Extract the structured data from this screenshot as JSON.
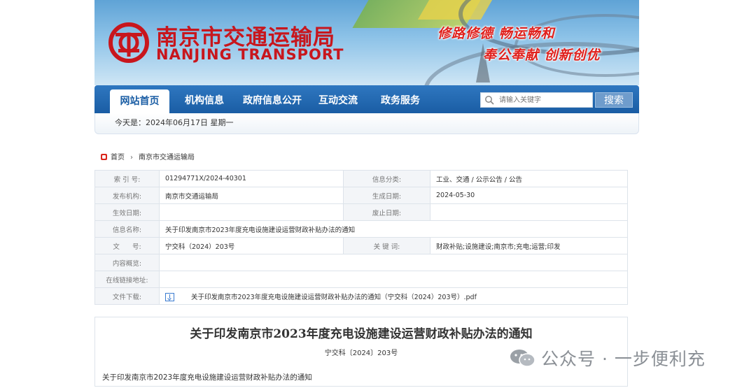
{
  "banner": {
    "site_name_cn": "南京市交通运输局",
    "site_name_en": "NANJING TRANSPORT",
    "slogan_line1": "修路修德  畅运畅和",
    "slogan_line2": "奉公奉献  创新创优"
  },
  "nav": {
    "items": [
      {
        "label": "网站首页"
      },
      {
        "label": "机构信息"
      },
      {
        "label": "政府信息公开"
      },
      {
        "label": "互动交流"
      },
      {
        "label": "政务服务"
      }
    ],
    "search_placeholder": "请输入关键字",
    "search_button": "搜索"
  },
  "dateline": "今天是：2024年06月17日  星期一",
  "breadcrumb": {
    "home": "首页",
    "current": "南京市交通运输局"
  },
  "info": {
    "index_label": "索 引 号:",
    "index_value": "01294771X/2024-40301",
    "category_label": "信息分类:",
    "category_value": "工业、交通 / 公示公告 / 公告",
    "publisher_label": "发布机构:",
    "publisher_value": "南京市交通运输局",
    "created_label": "生成日期:",
    "created_value": "2024-05-30",
    "effective_label": "生效日期:",
    "effective_value": "",
    "expiry_label": "废止日期:",
    "expiry_value": "",
    "name_label": "信息名称:",
    "name_value": "关于印发南京市2023年度充电设施建设运营财政补贴办法的通知",
    "docno_label": "文      号:",
    "docno_value": "宁交科（2024）203号",
    "keywords_label": "关 键 词:",
    "keywords_value": "财政补贴;设施建设;南京市;充电;运营;印发",
    "summary_label": "内容概览:",
    "summary_value": "",
    "link_label": "在线链接地址:",
    "link_value": "",
    "file_label": "文件下载:",
    "file_value": "关于印发南京市2023年度充电设施建设运营财政补贴办法的通知（宁交科（2024）203号）.pdf"
  },
  "article": {
    "title": "关于印发南京市2023年度充电设施建设运营财政补贴办法的通知",
    "docno": "宁交科〔2024〕203号",
    "body": "关于印发南京市2023年度充电设施建设运营财政补贴办法的通知"
  },
  "watermark": "公众号 · 一步便利充"
}
